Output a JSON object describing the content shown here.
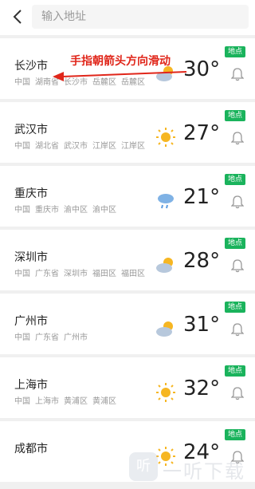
{
  "search": {
    "placeholder": "输入地址"
  },
  "badge_label": "地点",
  "annotation": "手指朝箭头方向滑动",
  "colors": {
    "badge": "#1ab35c",
    "annotation": "#e0261a"
  },
  "cities": [
    {
      "name": "长沙市",
      "path": [
        "中国",
        "湖南省",
        "长沙市",
        "岳麓区",
        "岳麓区"
      ],
      "temp": "30°",
      "weather_icon": "partly-cloudy-icon"
    },
    {
      "name": "武汉市",
      "path": [
        "中国",
        "湖北省",
        "武汉市",
        "江岸区",
        "江岸区"
      ],
      "temp": "27°",
      "weather_icon": "sun-icon"
    },
    {
      "name": "重庆市",
      "path": [
        "中国",
        "重庆市",
        "渝中区",
        "渝中区"
      ],
      "temp": "21°",
      "weather_icon": "rain-icon"
    },
    {
      "name": "深圳市",
      "path": [
        "中国",
        "广东省",
        "深圳市",
        "福田区",
        "福田区"
      ],
      "temp": "28°",
      "weather_icon": "partly-cloudy-icon"
    },
    {
      "name": "广州市",
      "path": [
        "中国",
        "广东省",
        "广州市"
      ],
      "temp": "31°",
      "weather_icon": "partly-cloudy-icon"
    },
    {
      "name": "上海市",
      "path": [
        "中国",
        "上海市",
        "黄浦区",
        "黄浦区"
      ],
      "temp": "32°",
      "weather_icon": "sun-icon"
    },
    {
      "name": "成都市",
      "path": [],
      "temp": "24°",
      "weather_icon": "sun-icon"
    }
  ],
  "watermark": {
    "logo": "听",
    "text": "一听下载"
  }
}
